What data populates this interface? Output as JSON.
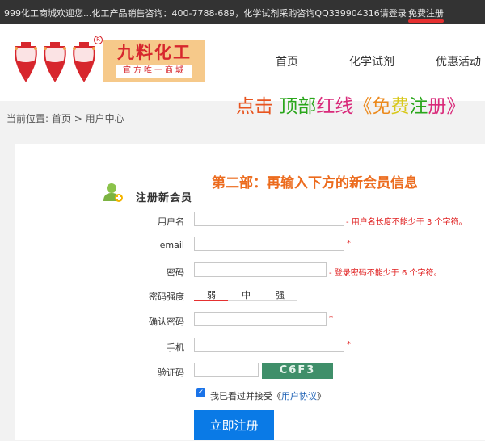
{
  "topbar": {
    "welcome_text": "999化工商城欢迎您...化工产品销售咨询：400-7788-689，化学试剂采购咨询QQ339904316请登录 |",
    "register_link": "免费注册"
  },
  "header": {
    "logo_main": "九料化工",
    "logo_sub": "官方唯一商城",
    "logo_reg": "R",
    "nav": [
      {
        "label": "首页"
      },
      {
        "label": "化学试剂"
      },
      {
        "label": "优惠活动"
      }
    ]
  },
  "banner": {
    "segments": [
      "点击",
      " 顶部",
      "红线",
      "《免",
      "费",
      "注",
      "册》"
    ],
    "colors": [
      "#e8541e",
      "#2aa61b",
      "#d92a7a",
      "#ec8a1d",
      "#d8c81a",
      "#2aa61b",
      "#d92a7a"
    ]
  },
  "breadcrumb": {
    "prefix": "当前位置:",
    "home": "首页",
    "sep": ">",
    "current": "用户中心"
  },
  "form": {
    "title": "注册新会员",
    "step_title": "第二部：再输入下方的新会员信息",
    "fields": {
      "username": {
        "label": "用户名",
        "value": "",
        "hint": "- 用户名长度不能少于 3 个字符。"
      },
      "email": {
        "label": "email",
        "value": "",
        "hint": "*"
      },
      "password": {
        "label": "密码",
        "value": "",
        "hint": "- 登录密码不能少于 6 个字符。"
      },
      "strength": {
        "label": "密码强度",
        "weak": "弱",
        "medium": "中",
        "strong": "强"
      },
      "confirm": {
        "label": "确认密码",
        "value": "",
        "hint": "*"
      },
      "phone": {
        "label": "手机",
        "value": "",
        "hint": "*"
      },
      "captcha": {
        "label": "验证码",
        "value": "",
        "code": "C6F3"
      }
    },
    "agree_prefix": "我已看过并接受《",
    "agree_link": "用户协议",
    "agree_suffix": "》",
    "submit": "立即注册"
  }
}
